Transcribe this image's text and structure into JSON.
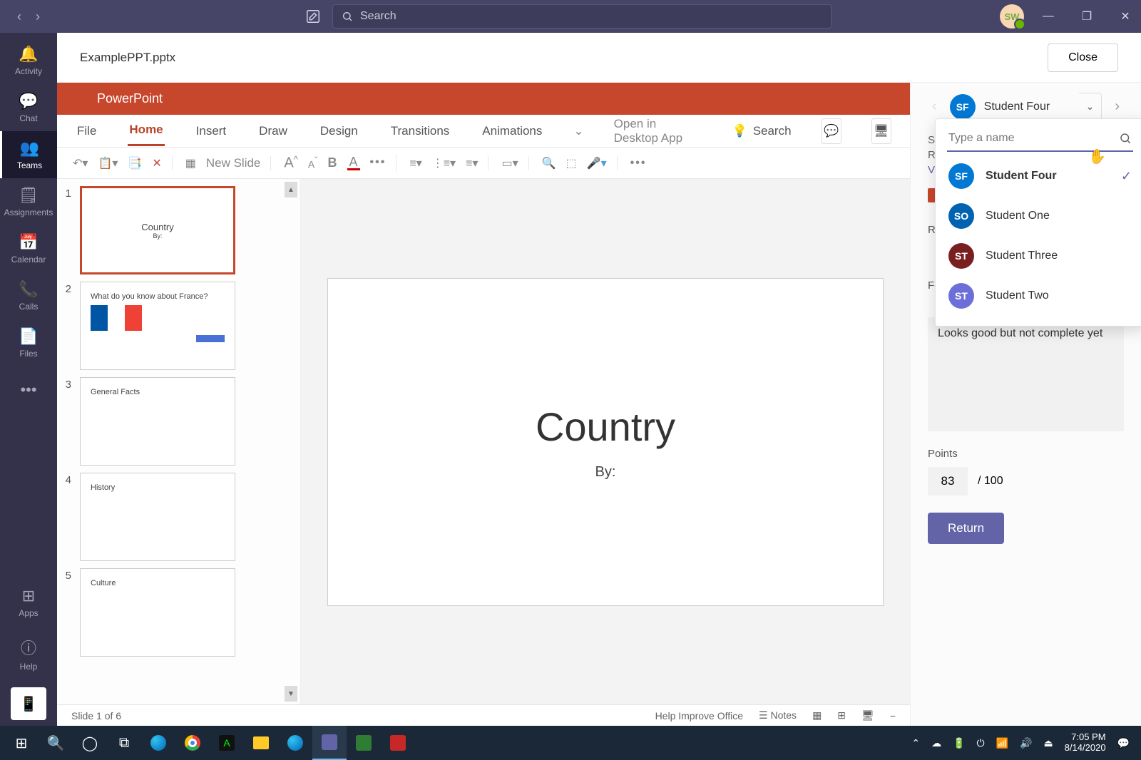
{
  "titlebar": {
    "search_placeholder": "Search",
    "avatar_initials": "SW"
  },
  "rail": {
    "items": [
      {
        "label": "Activity"
      },
      {
        "label": "Chat"
      },
      {
        "label": "Teams"
      },
      {
        "label": "Assignments"
      },
      {
        "label": "Calendar"
      },
      {
        "label": "Calls"
      },
      {
        "label": "Files"
      }
    ],
    "apps": "Apps",
    "help": "Help"
  },
  "doc": {
    "filename": "ExamplePPT.pptx",
    "close": "Close"
  },
  "ppt": {
    "brand": "PowerPoint",
    "tabs": {
      "file": "File",
      "home": "Home",
      "insert": "Insert",
      "draw": "Draw",
      "design": "Design",
      "transitions": "Transitions",
      "animations": "Animations"
    },
    "open_desktop": "Open in Desktop App",
    "search": "Search",
    "toolbar": {
      "newslide": "New Slide"
    },
    "slides": [
      {
        "num": "1",
        "title": "Country",
        "sub": "By:"
      },
      {
        "num": "2",
        "title": "What do you know about France?"
      },
      {
        "num": "3",
        "title": "General Facts"
      },
      {
        "num": "4",
        "title": "History"
      },
      {
        "num": "5",
        "title": "Culture"
      }
    ],
    "main_slide": {
      "title": "Country",
      "by": "By:"
    },
    "status": {
      "pos": "Slide 1 of 6",
      "help": "Help Improve Office",
      "notes": "Notes"
    }
  },
  "review": {
    "current_student": "Student Four",
    "current_initials": "SF",
    "current_color": "#0078d4",
    "dd_placeholder": "Type a name",
    "students": [
      {
        "initials": "SF",
        "name": "Student Four",
        "color": "#0078d4",
        "selected": true
      },
      {
        "initials": "SO",
        "name": "Student One",
        "color": "#0063b1",
        "selected": false
      },
      {
        "initials": "ST",
        "name": "Student Three",
        "color": "#7a1f1f",
        "selected": false
      },
      {
        "initials": "ST",
        "name": "Student Two",
        "color": "#6d6fd8",
        "selected": false
      }
    ],
    "trunc1": "Stud",
    "trunc2": "Retu",
    "trunc3": "View",
    "rubric_label": "Rub",
    "feedback_label_trunc": "Feed....",
    "feedback_label": "Feedback",
    "feedback_text": "Looks good but not complete yet",
    "points_label": "Points",
    "points_value": "83",
    "points_total": "/ 100",
    "return": "Return"
  },
  "taskbar": {
    "time": "7:05 PM",
    "date": "8/14/2020"
  }
}
